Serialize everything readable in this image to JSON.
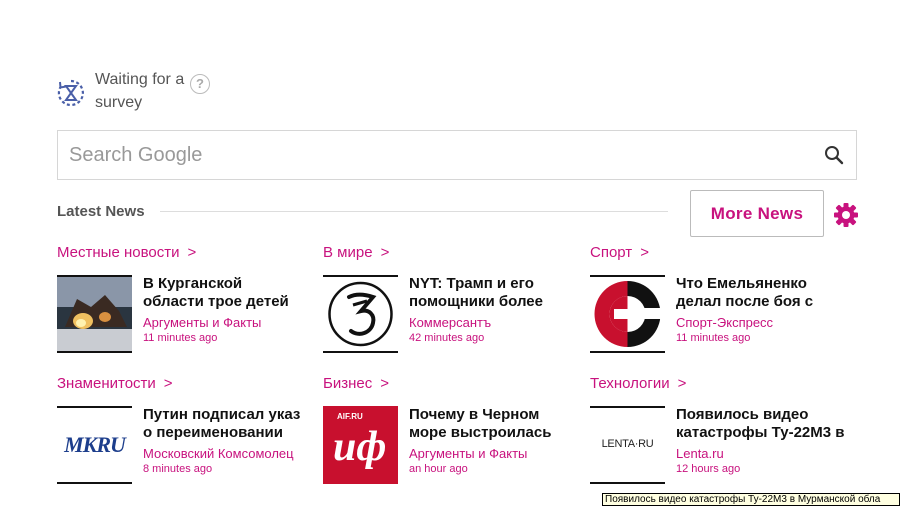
{
  "survey": {
    "text": "Waiting for a survey",
    "help": "?"
  },
  "search": {
    "placeholder": "Search Google",
    "value": ""
  },
  "news_header": {
    "title": "Latest News",
    "more_button": "More News"
  },
  "columns": [
    {
      "items": [
        {
          "category": "Местные новости",
          "headline": "В Курганской области трое детей",
          "source": "Аргументы и Факты",
          "time": "11 minutes ago"
        },
        {
          "category": "Знаменитости",
          "headline": "Путин подписал указ о переименовании",
          "source": "Московский Комсомолец",
          "time": "8 minutes ago"
        }
      ]
    },
    {
      "items": [
        {
          "category": "В мире",
          "headline": "NYT: Трамп и его помощники более",
          "source": "Коммерсантъ",
          "time": "42 minutes ago"
        },
        {
          "category": "Бизнес",
          "headline": "Почему в Черном море выстроилась",
          "source": "Аргументы и Факты",
          "time": "an hour ago"
        }
      ]
    },
    {
      "items": [
        {
          "category": "Спорт",
          "headline": "Что Емельяненко делал после боя с",
          "source": "Спорт-Экспресс",
          "time": "11 minutes ago"
        },
        {
          "category": "Технологии",
          "headline": "Появилось видео катастрофы Ту-22М3 в",
          "source": "Lenta.ru",
          "time": "12 hours ago"
        }
      ]
    }
  ],
  "cards": {
    "c0": {
      "category": "Местные новости",
      "line1": "В Курганской",
      "line2": "области трое детей",
      "source": "Аргументы и Факты",
      "time": "11 minutes ago",
      "thumb": "fire-photo"
    },
    "c1": {
      "category": "В мире",
      "line1": "NYT: Трамп и его",
      "line2": "помощники более",
      "source": "Коммерсантъ",
      "time": "42 minutes ago",
      "thumb": "kommersant-logo"
    },
    "c2": {
      "category": "Спорт",
      "line1": "Что Емельяненко",
      "line2": "делал после боя с",
      "source": "Спорт-Экспресс",
      "time": "11 minutes ago",
      "thumb": "sport-express-logo"
    },
    "c3": {
      "category": "Знаменитости",
      "line1": "Путин подписал указ",
      "line2": "о переименовании",
      "source": "Московский Комсомолец",
      "time": "8 minutes ago",
      "thumb": "mk-logo",
      "logo_text": "MKRU"
    },
    "c4": {
      "category": "Бизнес",
      "line1": "Почему в Черном",
      "line2": "море выстроилась",
      "source": "Аргументы и Факты",
      "time": "an hour ago",
      "thumb": "aif-logo",
      "logo_text": "AIF.RU",
      "logo_text2": "иф"
    },
    "c5": {
      "category": "Технологии",
      "line1": "Появилось видео",
      "line2": "катастрофы Ту-22М3 в",
      "source": "Lenta.ru",
      "time": "12 hours ago",
      "thumb": "lenta-logo",
      "logo_text": "LENTA·RU"
    }
  },
  "tooltip": {
    "text": "Появилось видео катастрофы Ту-22М3 в Мурманской обла"
  },
  "colors": {
    "accent": "#c8127e",
    "survey_icon": "#4a5fa8",
    "text_gray": "#555555"
  }
}
